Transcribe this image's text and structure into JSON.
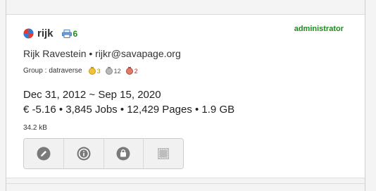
{
  "user": {
    "username": "rijk",
    "printer_count": "6",
    "role": "administrator",
    "full_name_line": "Rijk Ravestein • rijkr@savapage.org",
    "group_label": "Group :",
    "group_value": "datraverse",
    "badges": [
      {
        "icon": "medal-yellow-icon",
        "count": "3",
        "color": "#b58500"
      },
      {
        "icon": "medal-gray-icon",
        "count": "12",
        "color": "#555555"
      },
      {
        "icon": "medal-red-icon",
        "count": "2",
        "color": "#c03030"
      }
    ],
    "date_range": "Dec 31, 2012 ~ Sep 15, 2020",
    "stats_line": "€ -5.16 • 3,845 Jobs • 12,429 Pages • 1.9 GB",
    "size": "34.2 kB"
  },
  "actions": [
    {
      "icon": "pencil-icon"
    },
    {
      "icon": "info-icon"
    },
    {
      "icon": "bag-icon"
    },
    {
      "icon": "dotted-square-icon"
    }
  ],
  "colors": {
    "accent_green": "#1d8a1d",
    "action_icon": "#7a7a7a"
  }
}
